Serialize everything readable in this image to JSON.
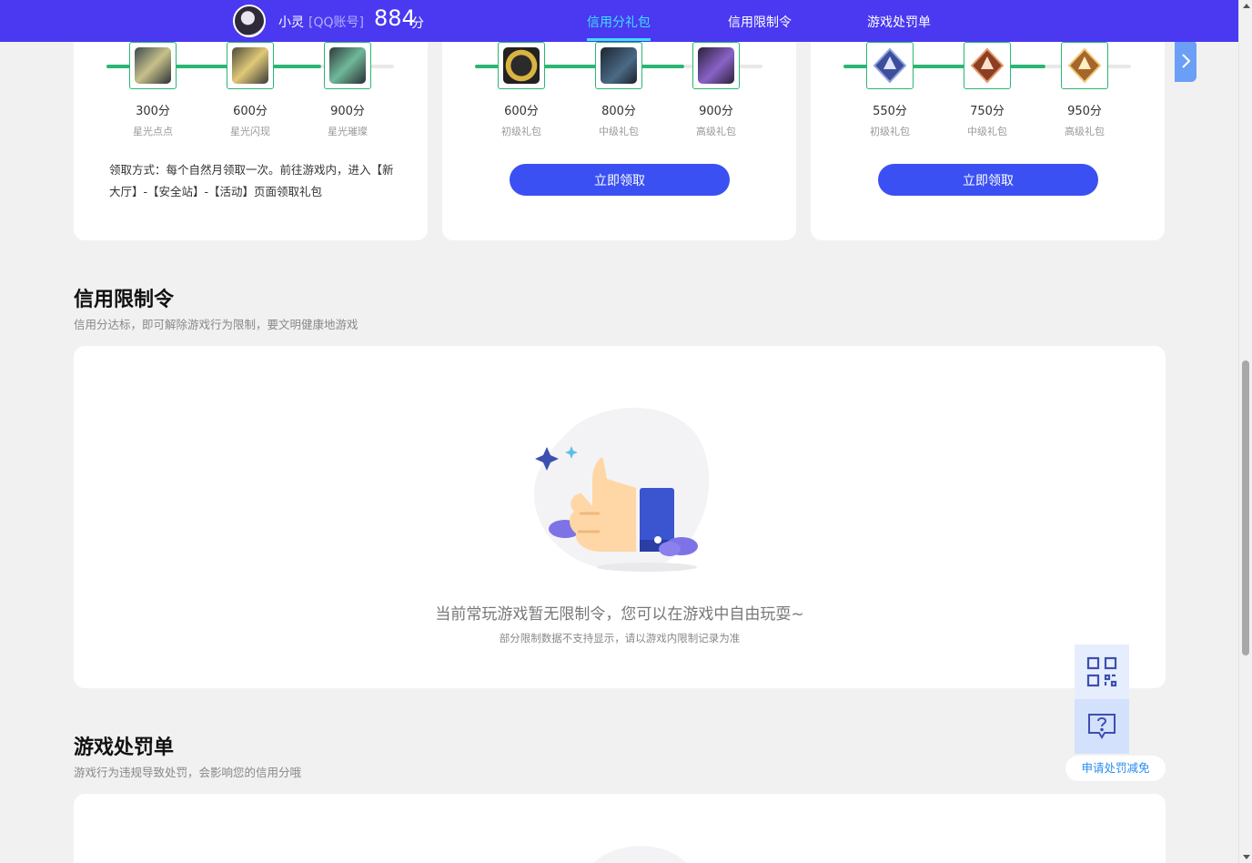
{
  "header": {
    "user_name": "小灵",
    "account_type": "[QQ账号]",
    "score": "884",
    "score_unit": "分",
    "tabs": [
      {
        "label": "信用分礼包",
        "active": true
      },
      {
        "label": "信用限制令",
        "active": false
      },
      {
        "label": "游戏处罚单",
        "active": false
      }
    ]
  },
  "reward_cards": [
    {
      "tiers": [
        {
          "score": "300分",
          "name": "星光点点",
          "icon": "drone-skin-icon"
        },
        {
          "score": "600分",
          "name": "星光闪现",
          "icon": "drone-skin-icon"
        },
        {
          "score": "900分",
          "name": "星光璀璨",
          "icon": "drone-skin-icon"
        }
      ],
      "claim_text": "领取方式：每个自然月领取一次。前往游戏内，进入【新大厅】-【安全站】-【活动】页面领取礼包"
    },
    {
      "tiers": [
        {
          "score": "600分",
          "name": "初级礼包",
          "icon": "coin-icon"
        },
        {
          "score": "800分",
          "name": "中级礼包",
          "icon": "xp-card-icon"
        },
        {
          "score": "900分",
          "name": "高级礼包",
          "icon": "crate-icon"
        }
      ],
      "button_label": "立即领取"
    },
    {
      "tiers": [
        {
          "score": "550分",
          "name": "初级礼包",
          "icon": "badge-blue-icon"
        },
        {
          "score": "750分",
          "name": "中级礼包",
          "icon": "badge-bronze-icon"
        },
        {
          "score": "950分",
          "name": "高级礼包",
          "icon": "badge-gold-icon"
        }
      ],
      "button_label": "立即领取"
    }
  ],
  "restriction": {
    "title": "信用限制令",
    "description": "信用分达标，即可解除游戏行为限制，要文明健康地游戏",
    "empty_title": "当前常玩游戏暂无限制令，您可以在游戏中自由玩耍~",
    "empty_subtitle": "部分限制数据不支持显示，请以游戏内限制记录为准"
  },
  "penalty": {
    "title": "游戏处罚单",
    "description": "游戏行为违规导致处罚，会影响您的信用分哦"
  },
  "floating": {
    "appeal_label": "申请处罚减免"
  },
  "colors": {
    "nav_bg": "#4a39f0",
    "active_tab": "#3fe0ff",
    "progress": "#2bb673",
    "button": "#3b50f2",
    "link": "#2a8cf0"
  }
}
